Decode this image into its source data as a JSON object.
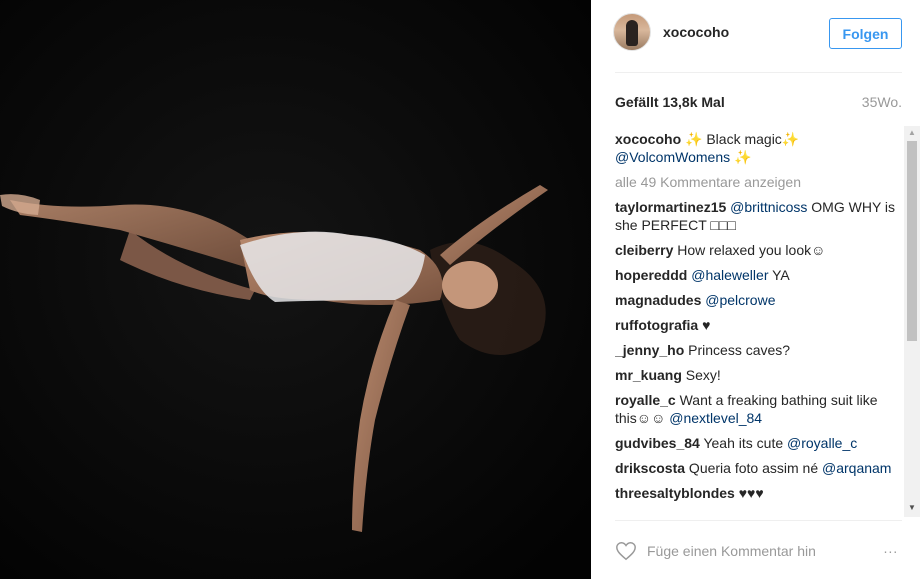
{
  "post": {
    "username": "xococoho",
    "follow_label": "Folgen",
    "likes": "Gefällt 13,8k Mal",
    "time": "35Wo."
  },
  "caption": {
    "username": "xococoho",
    "text1": " ✨ Black magic✨ ",
    "mention": "@VolcomWomens",
    "text2": " ✨"
  },
  "view_all": "alle 49 Kommentare anzeigen",
  "comments": [
    {
      "u": "taylormartinez15",
      "pre": " ",
      "mention": "@brittnicoss",
      "post": " OMG WHY is she PERFECT □□□"
    },
    {
      "u": "cleiberry",
      "pre": " How relaxed you look☺",
      "mention": "",
      "post": ""
    },
    {
      "u": "hopereddd",
      "pre": " ",
      "mention": "@haleweller",
      "post": " YA"
    },
    {
      "u": "magnadudes",
      "pre": " ",
      "mention": "@pelcrowe",
      "post": ""
    },
    {
      "u": "ruffotografia",
      "pre": " ♥",
      "mention": "",
      "post": ""
    },
    {
      "u": "_jenny_ho",
      "pre": " Princess caves?",
      "mention": "",
      "post": ""
    },
    {
      "u": "mr_kuang",
      "pre": " Sexy!",
      "mention": "",
      "post": ""
    },
    {
      "u": "royalle_c",
      "pre": " Want a freaking bathing suit like this☺☺ ",
      "mention": "@nextlevel_84",
      "post": ""
    },
    {
      "u": "gudvibes_84",
      "pre": " Yeah its cute ",
      "mention": "@royalle_c",
      "post": ""
    },
    {
      "u": "drikscosta",
      "pre": " Queria foto assim né ",
      "mention": "@arqanam",
      "post": ""
    },
    {
      "u": "threesaltyblondes",
      "pre": " ♥♥♥",
      "mention": "",
      "post": ""
    }
  ],
  "comment_box": {
    "placeholder": "Füge einen Kommentar hin",
    "more_label": "∙∙∙"
  },
  "icons": {
    "heart": "heart-icon",
    "more": "more-options-icon"
  },
  "colors": {
    "accent": "#3897f0",
    "mention": "#003569",
    "muted": "#999999"
  }
}
